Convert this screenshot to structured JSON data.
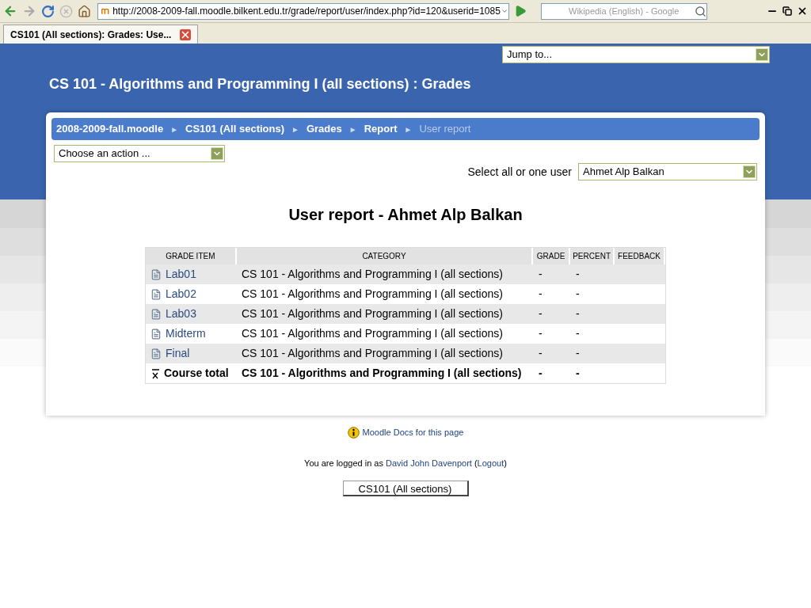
{
  "browser": {
    "address": "http://2008-2009-fall.moodle.bilkent.edu.tr/grade/report/user/index.php?id=120&userid=1085",
    "search_placeholder": "Wikipedia (English) - Google",
    "tabs": [
      {
        "label": "CS101 (All sections): Grades: Use...",
        "selected": true
      }
    ]
  },
  "jump_to": "Jump to...",
  "page_title": "CS 101 - Algorithms and Programming I (all sections) : Grades",
  "breadcrumb": [
    {
      "label": "2008-2009-fall.moodle",
      "current": false
    },
    {
      "label": "CS101 (All sections)",
      "current": false
    },
    {
      "label": "Grades",
      "current": false
    },
    {
      "label": "Report",
      "current": false
    },
    {
      "label": "User report",
      "current": true
    }
  ],
  "breadcrumb_separator": "►",
  "action_select": "Choose an action ...",
  "user_select": {
    "label": "Select all or one user",
    "value": "Ahmet Alp Balkan"
  },
  "report_title": "User report - Ahmet Alp Balkan",
  "table": {
    "columns": [
      "GRADE ITEM",
      "CATEGORY",
      "GRADE",
      "PERCENT",
      "FEEDBACK"
    ],
    "rows": [
      {
        "kind": "item",
        "item": "Lab01",
        "category": "CS 101 - Algorithms and Programming I (all sections)",
        "grade": "-",
        "percent": "-"
      },
      {
        "kind": "item",
        "item": "Lab02",
        "category": "CS 101 - Algorithms and Programming I (all sections)",
        "grade": "-",
        "percent": "-"
      },
      {
        "kind": "item",
        "item": "Lab03",
        "category": "CS 101 - Algorithms and Programming I (all sections)",
        "grade": "-",
        "percent": "-"
      },
      {
        "kind": "item",
        "item": "Midterm",
        "category": "CS 101 - Algorithms and Programming I (all sections)",
        "grade": "-",
        "percent": "-"
      },
      {
        "kind": "item",
        "item": "Final",
        "category": "CS 101 - Algorithms and Programming I (all sections)",
        "grade": "-",
        "percent": "-"
      },
      {
        "kind": "total",
        "item": "Course total",
        "category": "CS 101 - Algorithms and Programming I (all sections)",
        "grade": "-",
        "percent": "-"
      }
    ]
  },
  "docs_link": "Moodle Docs for this page",
  "login": [
    {
      "text": "You are logged in as ",
      "link": false
    },
    {
      "text": "David John Davenport",
      "link": true
    },
    {
      "text": " (",
      "link": false
    },
    {
      "text": "Logout",
      "link": true
    },
    {
      "text": ")",
      "link": false
    }
  ],
  "course_button": "CS101 (All sections)"
}
